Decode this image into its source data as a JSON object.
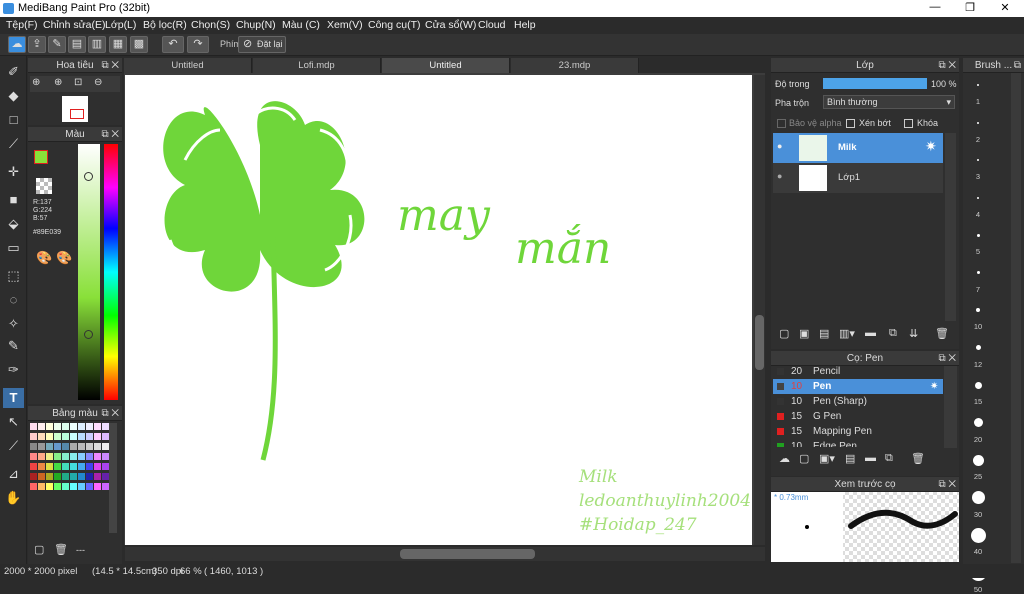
{
  "app": {
    "title": "MediBang Paint Pro (32bit)"
  },
  "window": {
    "minimize": "—",
    "maximize": "❐",
    "close": "✕"
  },
  "menu": [
    "Tệp(F)",
    "Chỉnh sửa(E)",
    "Lớp(L)",
    "Bộ lọc(R)",
    "Chọn(S)",
    "Chụp(N)",
    "Màu (C)",
    "Xem(V)",
    "Công cụ(T)",
    "Cửa sổ(W)",
    "Cloud",
    "Help"
  ],
  "toolbar": {
    "phim_label": "Phím",
    "reset_label": "Đặt lại"
  },
  "tabs": [
    "Untitled",
    "Lofi.mdp",
    "Untitled",
    "23.mdp"
  ],
  "navigator": {
    "title": "Hoa tiêu"
  },
  "color_panel": {
    "title": "Màu",
    "r": "R:137",
    "g": "G:224",
    "b": "B:57",
    "hex": "#89E039",
    "primary": "#89E039"
  },
  "palette": {
    "title": "Bảng màu",
    "footer": "---"
  },
  "layers": {
    "title": "Lớp",
    "opacity_label": "Độ trong",
    "opacity_value": "100 %",
    "blend_label": "Pha trộn",
    "blend_value": "Bình thường",
    "protect_alpha": "Bảo vệ alpha",
    "clipping": "Xén bớt",
    "lock": "Khóa",
    "items": [
      {
        "name": "Milk"
      },
      {
        "name": "Lớp1"
      }
    ]
  },
  "brush_panel": {
    "title": "Cọ: Pen",
    "items": [
      {
        "size": "20",
        "name": "Pencil",
        "color": "#333333"
      },
      {
        "size": "10",
        "name": "Pen",
        "color": "#444444"
      },
      {
        "size": "10",
        "name": "Pen (Sharp)",
        "color": "#333333"
      },
      {
        "size": "15",
        "name": "G Pen",
        "color": "#e02020"
      },
      {
        "size": "15",
        "name": "Mapping Pen",
        "color": "#e02020"
      },
      {
        "size": "10",
        "name": "Edge Pen",
        "color": "#20a020"
      }
    ]
  },
  "preview": {
    "title": "Xem trước cọ",
    "size": "* 0.73mm"
  },
  "brush_size": {
    "title": "Brush ...",
    "sizes": [
      "1",
      "2",
      "3",
      "4",
      "5",
      "7",
      "10",
      "12",
      "15",
      "20",
      "25",
      "30",
      "40",
      "50"
    ]
  },
  "canvas_text": {
    "word1": "may",
    "word2": "mắn",
    "sig1": "Milk",
    "sig2": "ledoanthuylinh2004",
    "sig3": "#Hoidap_247"
  },
  "status": {
    "size": "2000 * 2000 pixel",
    "cm": "(14.5 * 14.5cm)",
    "dpi": "350 dpi",
    "zoom": "66 %",
    "coords": "( 1460, 1013 )"
  }
}
